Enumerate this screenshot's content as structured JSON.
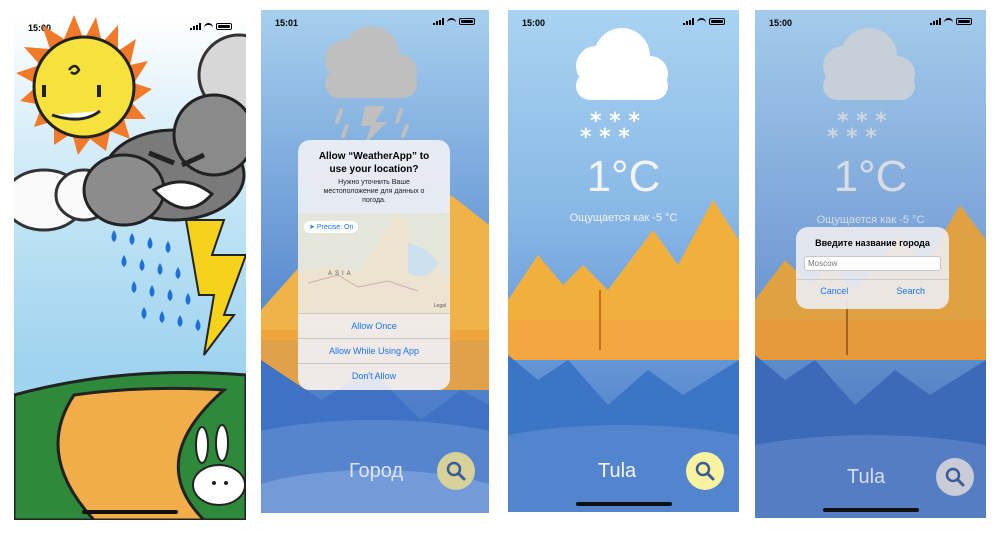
{
  "screens": [
    {
      "id": "splash",
      "status_time": "15:00"
    },
    {
      "id": "location-permission",
      "status_time": "15:01",
      "alert": {
        "title": "Allow “WeatherApp” to use your location?",
        "message": "Нужно уточнить Ваше местоположение для данных о погода.",
        "precise_label": "Precise: On",
        "map_label": "ASIA",
        "map_credit": "Legal",
        "buttons": [
          "Allow Once",
          "Allow While Using App",
          "Don't Allow"
        ]
      },
      "city": "Город"
    },
    {
      "id": "weather",
      "status_time": "15:00",
      "temperature": "1°C",
      "feels_like": "Ощущается как  -5 °C",
      "city": "Tula"
    },
    {
      "id": "city-search",
      "status_time": "15:00",
      "temperature": "1°C",
      "feels_like": "Ощущается как  -5 °C",
      "city": "Tula",
      "dialog": {
        "title": "Введите название города",
        "placeholder": "Moscow",
        "cancel": "Cancel",
        "search": "Search"
      }
    }
  ],
  "colors": {
    "sky_top": "#a9d3f2",
    "sun": "#f7e13c",
    "mountain": "#f2a83a",
    "water": "#3f78c8",
    "ios_blue": "#1b74e8",
    "search_button_active": "#f9f3a0"
  }
}
